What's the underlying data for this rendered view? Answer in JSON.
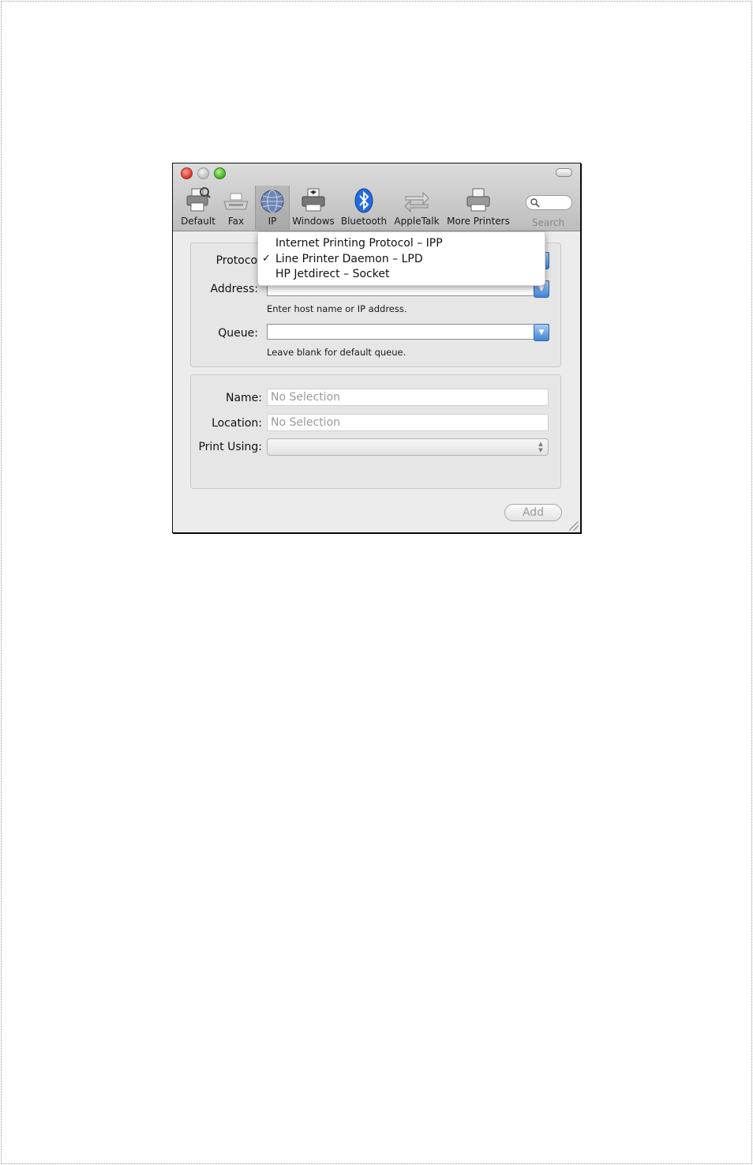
{
  "toolbar": {
    "items": [
      {
        "label": "Default",
        "icon": "default-printer-icon"
      },
      {
        "label": "Fax",
        "icon": "fax-icon"
      },
      {
        "label": "IP",
        "icon": "globe-icon"
      },
      {
        "label": "Windows",
        "icon": "windows-printer-icon"
      },
      {
        "label": "Bluetooth",
        "icon": "bluetooth-icon"
      },
      {
        "label": "AppleTalk",
        "icon": "appletalk-arrows-icon"
      },
      {
        "label": "More Printers",
        "icon": "printer-icon"
      }
    ],
    "selected": "IP",
    "search_label": "Search"
  },
  "connection": {
    "protocol_label": "Protocol",
    "address_label": "Address:",
    "address_hint": "Enter host name or IP address.",
    "queue_label": "Queue:",
    "queue_hint": "Leave blank for default queue."
  },
  "printer": {
    "name_label": "Name:",
    "name_value": "No Selection",
    "location_label": "Location:",
    "location_value": "No Selection",
    "print_using_label": "Print Using:"
  },
  "add_label": "Add",
  "protocol_menu": {
    "items": [
      "Internet Printing Protocol – IPP",
      "Line Printer Daemon – LPD",
      "HP Jetdirect – Socket"
    ],
    "checked": "Line Printer Daemon – LPD",
    "check_glyph": "✓"
  },
  "colors": {
    "accent": "#3e83d6",
    "window_bg": "#ececec"
  }
}
